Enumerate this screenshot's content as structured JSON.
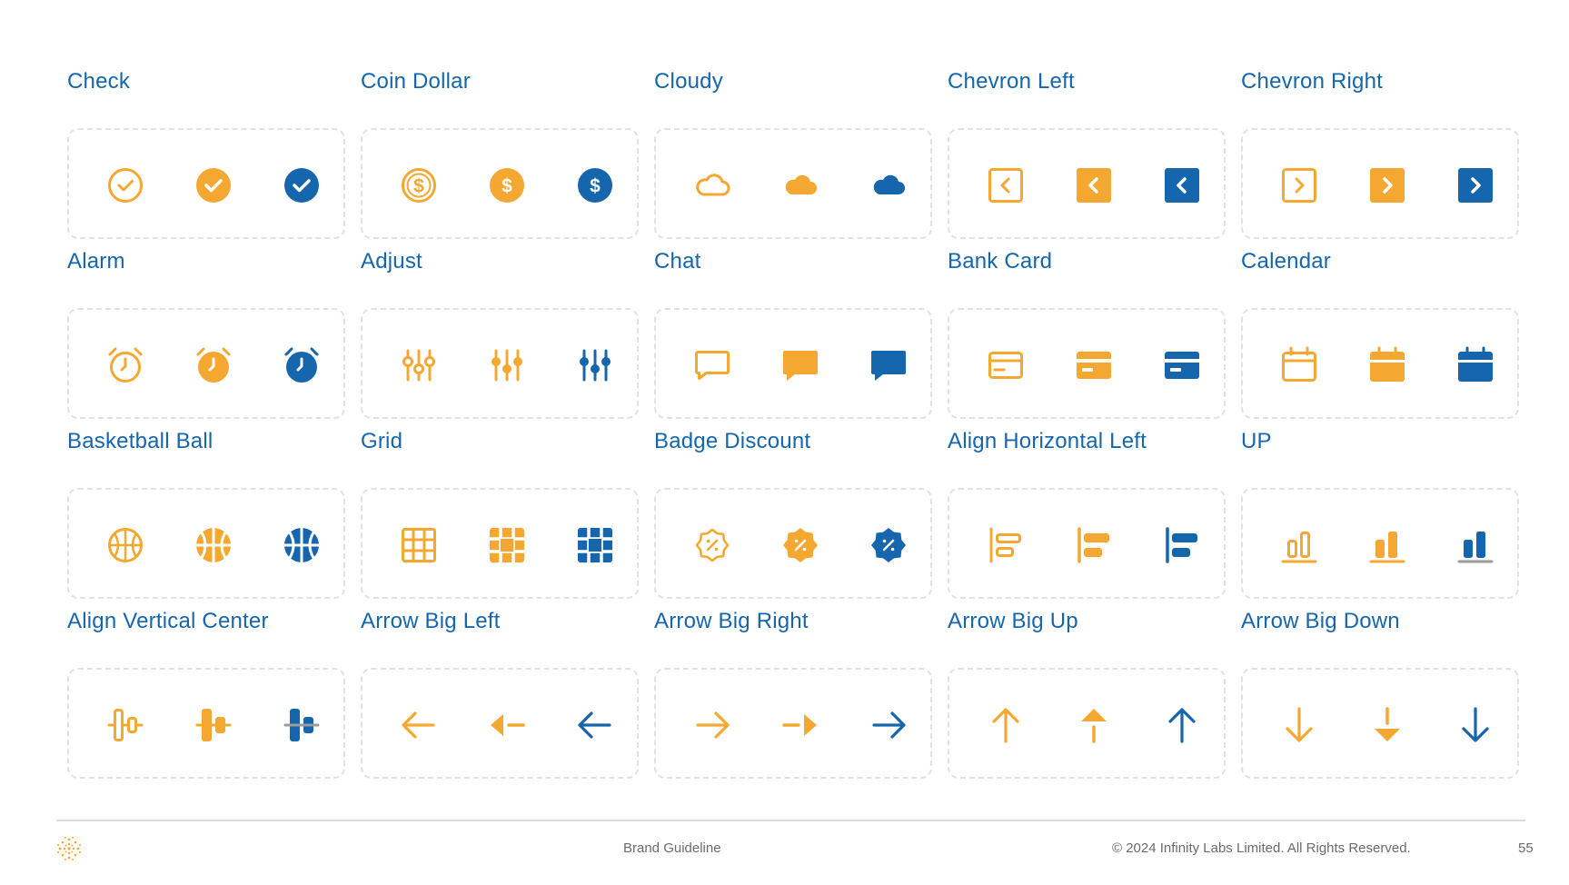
{
  "colors": {
    "orange": "#f4a831",
    "blue": "#1566ad",
    "title": "#1566ad",
    "border": "#e1e1e1"
  },
  "icon_sets": [
    {
      "title": "Check",
      "icon": "check-circle-icon"
    },
    {
      "title": "Coin Dollar",
      "icon": "coin-dollar-icon"
    },
    {
      "title": "Cloudy",
      "icon": "cloud-icon"
    },
    {
      "title": "Chevron Left",
      "icon": "chevron-left-icon"
    },
    {
      "title": "Chevron Right",
      "icon": "chevron-right-icon"
    },
    {
      "title": "Alarm",
      "icon": "alarm-icon"
    },
    {
      "title": "Adjust",
      "icon": "adjust-icon"
    },
    {
      "title": "Chat",
      "icon": "chat-icon"
    },
    {
      "title": "Bank Card",
      "icon": "bank-card-icon"
    },
    {
      "title": "Calendar",
      "icon": "calendar-icon"
    },
    {
      "title": "Basketball Ball",
      "icon": "basketball-icon"
    },
    {
      "title": "Grid",
      "icon": "grid-icon"
    },
    {
      "title": "Badge Discount",
      "icon": "badge-discount-icon"
    },
    {
      "title": "Align Horizontal Left",
      "icon": "align-horizontal-left-icon"
    },
    {
      "title": "UP",
      "icon": "bar-chart-up-icon"
    },
    {
      "title": "Align Vertical Center",
      "icon": "align-vertical-center-icon"
    },
    {
      "title": "Arrow Big Left",
      "icon": "arrow-left-icon"
    },
    {
      "title": "Arrow Big Right",
      "icon": "arrow-right-icon"
    },
    {
      "title": "Arrow Big Up",
      "icon": "arrow-up-icon"
    },
    {
      "title": "Arrow Big Down",
      "icon": "arrow-down-icon"
    }
  ],
  "icon_variants": [
    "outline-orange",
    "filled-orange",
    "filled-blue"
  ],
  "footer": {
    "center": "Brand Guideline",
    "copyright": "© 2024 Infinity Labs Limited. All Rights Reserved.",
    "page": "55",
    "logo_icon": "dotted-star-logo-icon"
  }
}
